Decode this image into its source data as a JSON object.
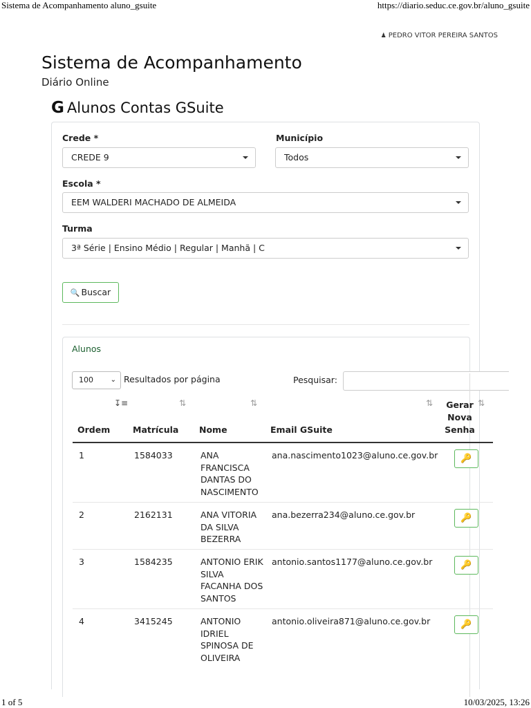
{
  "print": {
    "title": "Sistema de Acompanhamento aluno_gsuite",
    "url": "https://diario.seduc.ce.gov.br/aluno_gsuite",
    "page": "1 of 5",
    "datetime": "10/03/2025, 13:26"
  },
  "user": {
    "name": "PEDRO VITOR PEREIRA SANTOS",
    "icon": "user-icon"
  },
  "app": {
    "title": "Sistema de Acompanhamento",
    "subtitle": "Diário Online"
  },
  "page_title": {
    "icon_glyph": "G",
    "icon": "google-g-icon",
    "text": "Alunos Contas GSuite"
  },
  "filters": {
    "crede": {
      "label": "Crede *",
      "value": "CREDE 9"
    },
    "municipio": {
      "label": "Município",
      "value": "Todos"
    },
    "escola": {
      "label": "Escola *",
      "value": "EEM WALDERI MACHADO DE ALMEIDA"
    },
    "turma": {
      "label": "Turma",
      "value": "3ª Série | Ensino Médio | Regular | Manhã | C"
    },
    "search_button": "Buscar"
  },
  "alunos": {
    "title": "Alunos",
    "page_length": "100",
    "page_length_label": "Resultados por página",
    "search_label": "Pesquisar:",
    "search_value": "",
    "columns": [
      "Ordem",
      "Matrícula",
      "Nome",
      "Email GSuite",
      "Gerar Nova Senha"
    ],
    "rows": [
      {
        "ordem": "1",
        "matricula": "1584033",
        "nome": "ANA FRANCISCA DANTAS DO NASCIMENTO",
        "email": "ana.nascimento1023@aluno.ce.gov.br"
      },
      {
        "ordem": "2",
        "matricula": "2162131",
        "nome": "ANA VITORIA DA SILVA BEZERRA",
        "email": "ana.bezerra234@aluno.ce.gov.br"
      },
      {
        "ordem": "3",
        "matricula": "1584235",
        "nome": "ANTONIO ERIK SILVA FACANHA DOS SANTOS",
        "email": "antonio.santos1177@aluno.ce.gov.br"
      },
      {
        "ordem": "4",
        "matricula": "3415245",
        "nome": "ANTONIO IDRIEL SPINOSA DE OLIVEIRA",
        "email": "antonio.oliveira871@aluno.ce.gov.br"
      }
    ],
    "action_icon": "key-icon"
  }
}
